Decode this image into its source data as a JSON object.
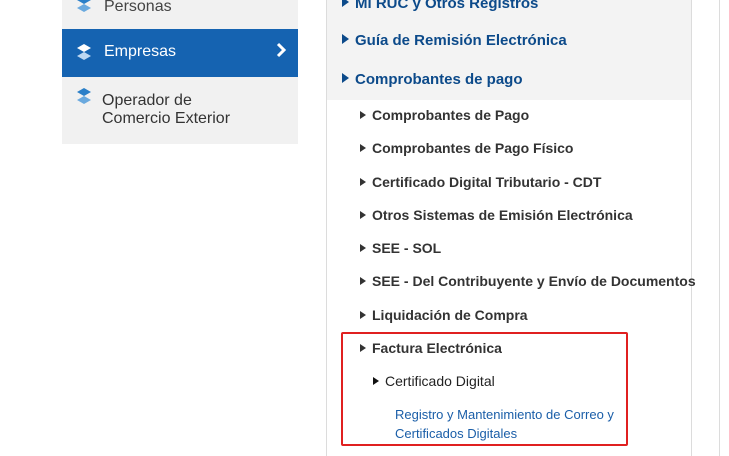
{
  "sidebar": {
    "items": [
      {
        "label": "Personas",
        "icon": "sunat-logo-icon"
      },
      {
        "label": "Empresas",
        "icon": "sunat-logo-icon",
        "active": true
      },
      {
        "label_line1": "Operador de",
        "label_line2": "Comercio Exterior",
        "icon": "sunat-logo-icon"
      }
    ]
  },
  "menu": {
    "top_items": [
      {
        "label": "Mi RUC y Otros Registros"
      },
      {
        "label": "Guía de Remisión Electrónica"
      },
      {
        "label": "Comprobantes de pago"
      }
    ],
    "sub_items": [
      {
        "label": "Comprobantes de Pago"
      },
      {
        "label": "Comprobantes de Pago Físico"
      },
      {
        "label": "Certificado Digital Tributario - CDT"
      },
      {
        "label": "Otros Sistemas de Emisión Electrónica"
      },
      {
        "label": "SEE - SOL"
      },
      {
        "label": "SEE - Del Contribuyente y Envío de Documentos"
      },
      {
        "label": "Liquidación de Compra"
      },
      {
        "label": "Factura Electrónica"
      }
    ],
    "subsub_item": {
      "label": "Certificado Digital"
    },
    "link": {
      "line1": "Registro y Mantenimiento de Correo y",
      "line2": "Certificados Digitales"
    }
  },
  "colors": {
    "active_bg": "#1563b1",
    "menu_blue": "#0c4a8a",
    "link_blue": "#1a5ea8",
    "highlight": "#e02020",
    "sidebar_bg": "#f1f1f1"
  }
}
